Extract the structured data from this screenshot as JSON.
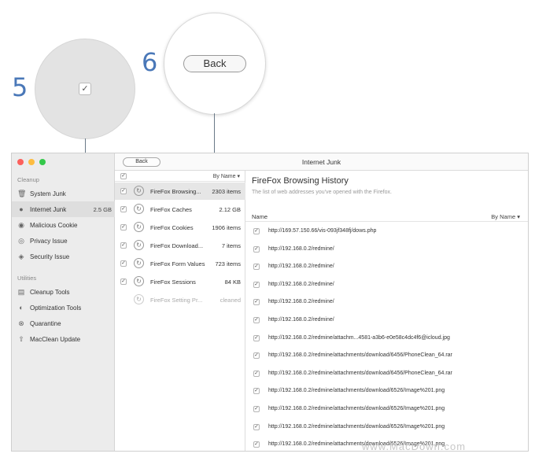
{
  "callouts": {
    "num5": "5",
    "num6": "6",
    "back_label": "Back"
  },
  "sidebar": {
    "cleanup_header": "Cleanup",
    "utilities_header": "Utilities",
    "cleanup_items": [
      {
        "label": "System Junk",
        "icon": "trash-icon",
        "size": ""
      },
      {
        "label": "Internet Junk",
        "icon": "globe-icon",
        "size": "2.5 GB"
      },
      {
        "label": "Malicious Cookie",
        "icon": "cookie-icon",
        "size": ""
      },
      {
        "label": "Privacy Issue",
        "icon": "eye-icon",
        "size": ""
      },
      {
        "label": "Security Issue",
        "icon": "shield-icon",
        "size": ""
      }
    ],
    "utility_items": [
      {
        "label": "Cleanup Tools",
        "icon": "toolbox-icon"
      },
      {
        "label": "Optimization Tools",
        "icon": "gauge-icon"
      },
      {
        "label": "Quarantine",
        "icon": "quarantine-icon"
      },
      {
        "label": "MacClean Update",
        "icon": "update-icon"
      }
    ]
  },
  "titlebar": {
    "back_label": "Back",
    "title": "Internet Junk"
  },
  "middle": {
    "sort_label": "By Name",
    "rows": [
      {
        "label": "FireFox Browsing...",
        "count": "2303 items",
        "checked": true
      },
      {
        "label": "FireFox Caches",
        "count": "2.12 GB",
        "checked": true
      },
      {
        "label": "FireFox Cookies",
        "count": "1906 items",
        "checked": true
      },
      {
        "label": "FireFox Download...",
        "count": "7 items",
        "checked": true
      },
      {
        "label": "FireFox Form Values",
        "count": "723 items",
        "checked": true
      },
      {
        "label": "FireFox Sessions",
        "count": "84 KB",
        "checked": true
      },
      {
        "label": "FireFox Setting Pr...",
        "count": "cleaned",
        "checked": false
      }
    ]
  },
  "detail": {
    "title": "FireFox Browsing History",
    "subtitle": "The list of web addresses you've opened with the Firefox.",
    "name_header": "Name",
    "sort_label": "By Name",
    "urls": [
      "http://169.57.150.66/vis-093jf348fj/dows.php",
      "http://192.168.0.2/redmine/",
      "http://192.168.0.2/redmine/",
      "http://192.168.0.2/redmine/",
      "http://192.168.0.2/redmine/",
      "http://192.168.0.2/redmine/",
      "http://192.168.0.2/redmine/attachm...4581-a3b6-e0e58c4dc4f6@icloud.jpg",
      "http://192.168.0.2/redmine/attachments/download/6456/PhoneClean_64.rar",
      "http://192.168.0.2/redmine/attachments/download/6456/PhoneClean_64.rar",
      "http://192.168.0.2/redmine/attachments/download/6526/Image%201.png",
      "http://192.168.0.2/redmine/attachments/download/6526/Image%201.png",
      "http://192.168.0.2/redmine/attachments/download/6526/Image%201.png",
      "http://192.168.0.2/redmine/attachments/download/6526/Image%201.png"
    ]
  },
  "watermark": "www.MacDown.com",
  "colors": {
    "accent": "#4a78b8",
    "close": "#fc605c",
    "minimize": "#fdbc40",
    "zoom": "#34c84a"
  }
}
